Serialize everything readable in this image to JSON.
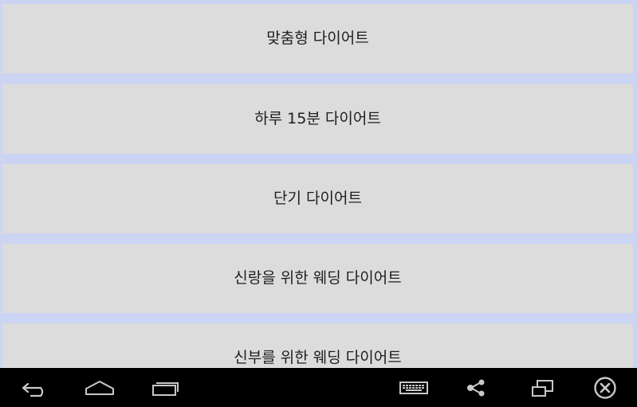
{
  "menu": {
    "items": [
      {
        "label": "맞춤형 다이어트"
      },
      {
        "label": "하루 15분 다이어트"
      },
      {
        "label": "단기 다이어트"
      },
      {
        "label": "신랑을 위한 웨딩 다이어트"
      },
      {
        "label": "신부를 위한 웨딩 다이어트"
      }
    ]
  },
  "navbar": {
    "icons": [
      "back-icon",
      "home-icon",
      "recent-apps-icon",
      "keyboard-icon",
      "share-icon",
      "window-resize-icon",
      "close-icon"
    ],
    "icon_color": "#c8c8c8",
    "background": "#000000"
  },
  "colors": {
    "list_background": "#ccd4f4",
    "item_background": "#dcdcdc",
    "item_text": "#1e1e1e"
  }
}
